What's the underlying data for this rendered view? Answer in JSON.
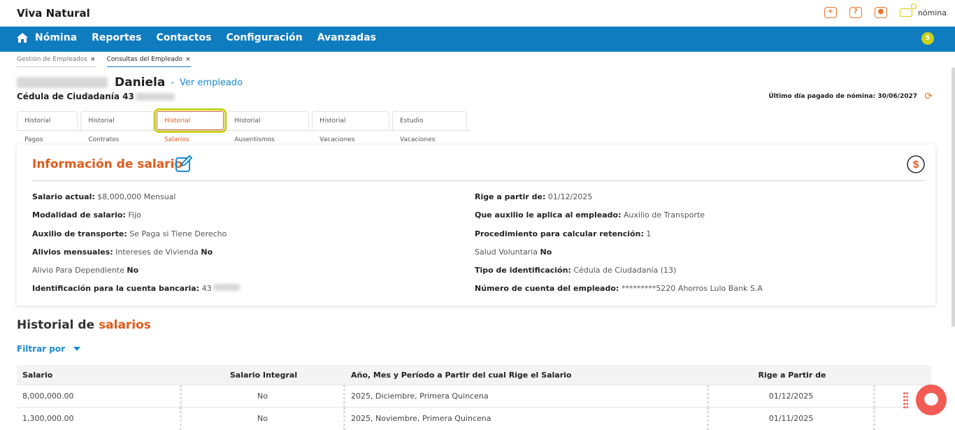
{
  "app": {
    "brand": "Viva Natural",
    "logo_label": "nómina"
  },
  "top_icons": [
    "plus-icon",
    "help-icon",
    "user-icon"
  ],
  "nav": {
    "items": [
      "Nómina",
      "Reportes",
      "Contactos",
      "Configuración",
      "Avanzadas"
    ],
    "notifications": "5"
  },
  "crumbs": [
    {
      "label": "Gestión de Empleados",
      "close": "×"
    },
    {
      "label": "Consultas del Empleado",
      "close": "×"
    }
  ],
  "employee": {
    "first_name": "Daniela",
    "separator": "-",
    "view_link": "Ver empleado",
    "id_label": "Cédula de Ciudadanía 43"
  },
  "last_paid": "Último día pagado de nómina: 30/06/2027",
  "tabs": [
    "Historial Pagos",
    "Historial Contratos",
    "Historial Salarios",
    "Historial Ausentismos",
    "Historial Vacaciones",
    "Estudio Vacaciones"
  ],
  "salary_info": {
    "title": "Información de salario",
    "left": [
      {
        "label": "Salario actual:",
        "value": "$8,000,000 Mensual"
      },
      {
        "label": "Modalidad de salario:",
        "value": "Fijo"
      },
      {
        "label": "Auxilio de transporte:",
        "value": "Se Paga si Tiene Derecho"
      },
      {
        "label": "Alivios mensuales:",
        "value": "Intereses de Vivienda",
        "extra": "No"
      },
      {
        "label": "",
        "value": "Alivio Para Dependiente",
        "extra": "No"
      },
      {
        "label": "Identificación para la cuenta bancaria:",
        "value": "43"
      }
    ],
    "right": [
      {
        "label": "Rige a partir de:",
        "value": "01/12/2025"
      },
      {
        "label": "Que auxilio le aplica al empleado:",
        "value": "Auxilio de Transporte"
      },
      {
        "label": "Procedimiento para calcular retención:",
        "value": "1"
      },
      {
        "label": "",
        "value": "Salud Voluntaria",
        "extra": "No"
      },
      {
        "label": "Tipo de identificación:",
        "value": "Cédula de Ciudadanía (13)"
      },
      {
        "label": "Número de cuenta del empleado:",
        "value": "*********5220 Ahorros Lulo Bank S.A"
      }
    ]
  },
  "history": {
    "title_plain": "Historial de",
    "title_accent": "salarios",
    "filter_label": "Filtrar por",
    "columns": [
      "Salario",
      "Salario Integral",
      "Año, Mes y Período a Partir del cual Rige el Salario",
      "Rige a Partir de"
    ],
    "rows": [
      [
        "8,000,000.00",
        "No",
        "2025, Diciembre, Primera Quincena",
        "01/12/2025"
      ],
      [
        "1,300,000.00",
        "No",
        "2025, Noviembre, Primera Quincena",
        "01/11/2025"
      ]
    ]
  },
  "colors": {
    "nav_blue": "#0f7cc0",
    "accent_orange": "#e05a1a",
    "link_blue": "#1a8ad4",
    "highlight": "#c9d21b",
    "chat": "#f25c54"
  }
}
